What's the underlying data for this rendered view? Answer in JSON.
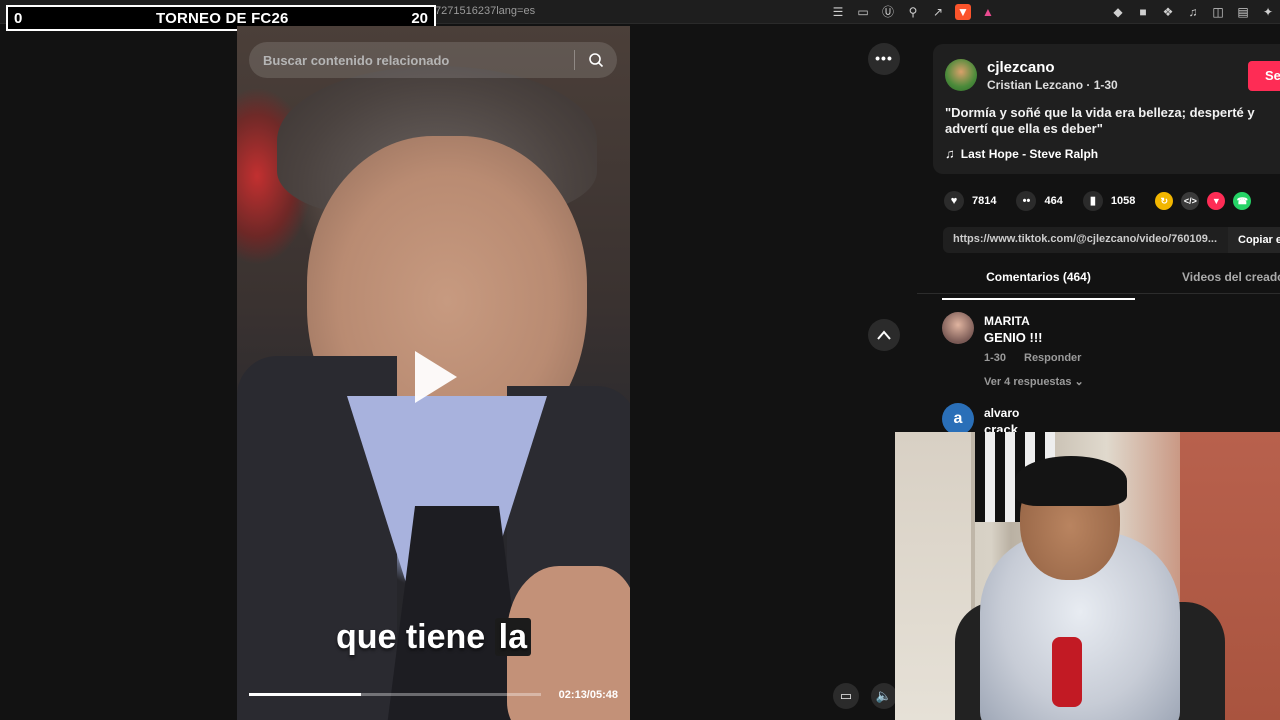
{
  "browser": {
    "url": "tiktok.com/@cjlezcano/video/7601091667271516237lang=es",
    "icons_left": [
      "settings-icon"
    ],
    "icons_right": [
      "reader-icon",
      "cast-icon",
      "translate-icon",
      "zoom-icon",
      "share-icon",
      "brave-shield-icon",
      "brave-rewards-icon",
      "extension-icon",
      "extension-icon",
      "puzzle-icon",
      "music-icon",
      "sidebar-icon",
      "wallet-icon",
      "leo-icon",
      "vpn-icon"
    ]
  },
  "scoreboard": {
    "left": "0",
    "title": "TORNEO DE FC26",
    "right": "20"
  },
  "video": {
    "search_placeholder": "Buscar contenido relacionado",
    "caption_start": "que tiene ",
    "caption_end": "la",
    "time": "02:13/05:48",
    "progress": 0.385
  },
  "post": {
    "username": "cjlezcano",
    "meta": "Cristian Lezcano · 1-30",
    "follow": "Se",
    "description": "\"Dormía y soñé que la vida era belleza; desperté y advertí que ella es deber\"",
    "music": "Last Hope - Steve Ralph",
    "likes": "7814",
    "comments": "464",
    "saves": "1058",
    "link": "https://www.tiktok.com/@cjlezcano/video/760109...",
    "copy": "Copiar e"
  },
  "tabs": {
    "comments": "Comentarios (464)",
    "creator": "Videos del creador"
  },
  "comments": [
    {
      "name": "MARITA",
      "text": "GENIO !!!",
      "date": "1-30",
      "reply": "Responder",
      "more": "Ver 4 respuestas"
    },
    {
      "name": "alvaro",
      "text": "crack",
      "avatar_letter": "a"
    }
  ],
  "colors": {
    "accent": "#fe2c55",
    "panel": "#121212",
    "card": "#1f1f1f"
  }
}
